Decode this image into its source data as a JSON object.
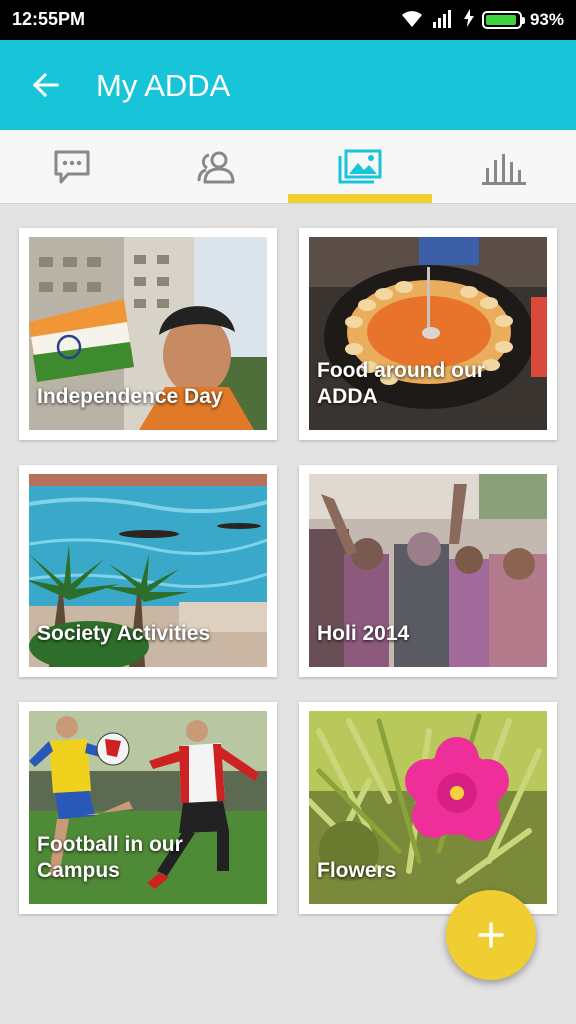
{
  "status_bar": {
    "time": "12:55PM",
    "battery": "93%"
  },
  "app_bar": {
    "title": "My ADDA"
  },
  "tabs": [
    {
      "name": "tab-chat",
      "icon": "chat-icon"
    },
    {
      "name": "tab-members",
      "icon": "members-icon"
    },
    {
      "name": "tab-gallery",
      "icon": "gallery-icon",
      "selected": true
    },
    {
      "name": "tab-stats",
      "icon": "bar-chart-icon"
    }
  ],
  "albums": [
    {
      "label": "Independence Day"
    },
    {
      "label": "Food around our ADDA"
    },
    {
      "label": "Society Activities"
    },
    {
      "label": "Holi 2014"
    },
    {
      "label": "Football in our Campus"
    },
    {
      "label": "Flowers"
    }
  ],
  "fab": {
    "label": "+"
  },
  "colors": {
    "app_bar": "#18c4d8",
    "accent": "#f0cf2e",
    "tab_active": "#18c4d8",
    "tab_inactive": "#888888"
  }
}
